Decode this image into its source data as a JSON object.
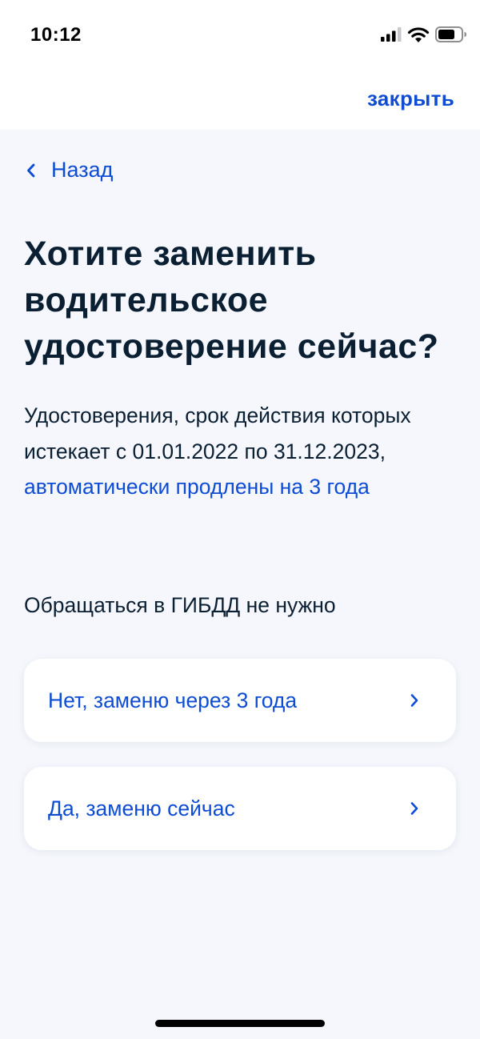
{
  "status_bar": {
    "time": "10:12"
  },
  "icons": {
    "signal": "signal-icon",
    "wifi": "wifi-icon",
    "battery": "battery-icon",
    "back": "chevron-left-icon",
    "forward": "chevron-right-icon"
  },
  "header": {
    "close_label": "закрыть"
  },
  "nav": {
    "back_label": "Назад"
  },
  "page": {
    "title": "Хотите заменить водительское удостоверение сейчас?",
    "description_text": "Удостоверения, срок действия которых истекает с 01.01.2022 по 31.12.2023, ",
    "description_link": "автоматически продлены на 3 года",
    "note": "Обращаться в ГИБДД не нужно"
  },
  "options": [
    {
      "label": "Нет, заменю через 3 года"
    },
    {
      "label": "Да, заменю сейчас"
    }
  ],
  "colors": {
    "accent": "#0d4cd3",
    "text": "#0b1f33",
    "background": "#f5f7fd",
    "card": "#ffffff"
  }
}
